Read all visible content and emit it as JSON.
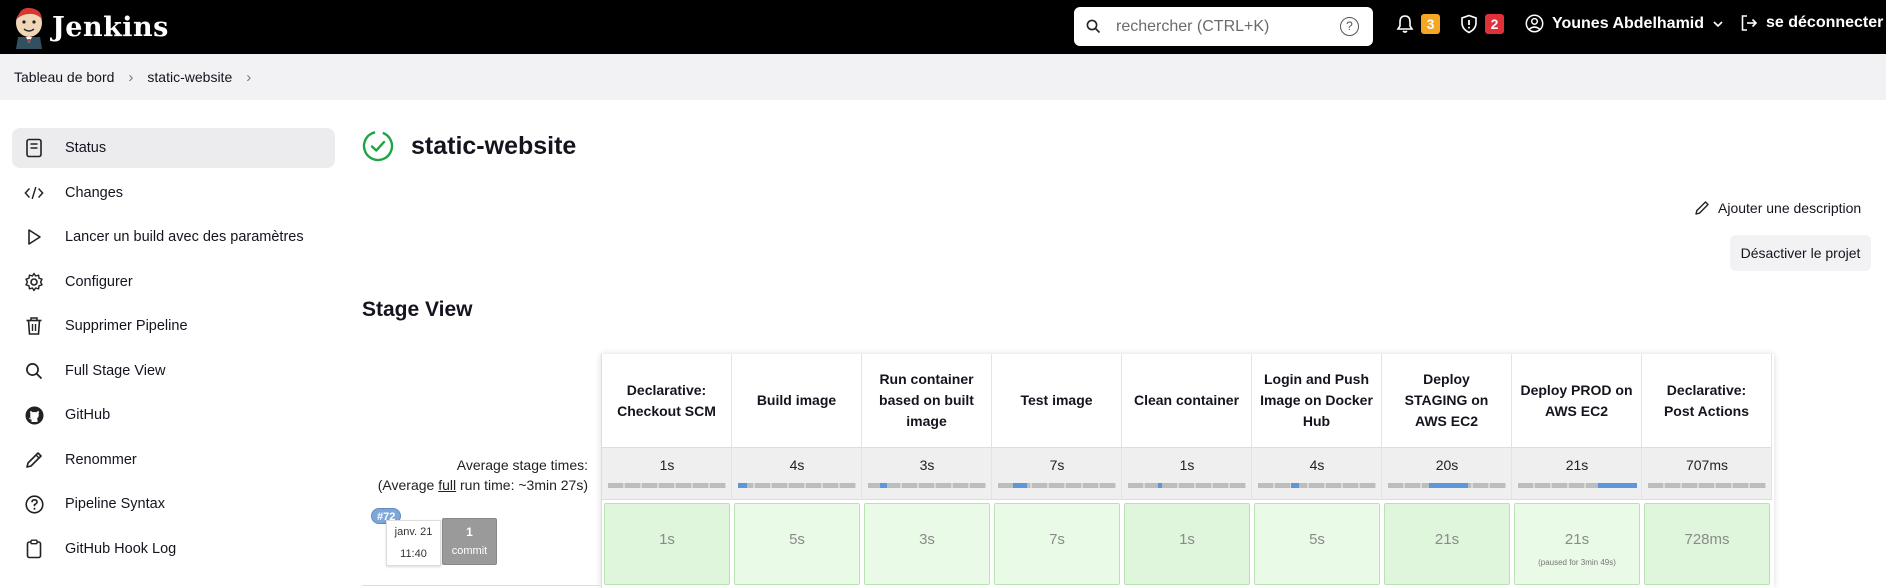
{
  "header": {
    "brand": "Jenkins",
    "search_placeholder": "rechercher (CTRL+K)",
    "help_glyph": "?",
    "notifications_count": "3",
    "security_count": "2",
    "user_name": "Younes Abdelhamid",
    "logout_label": "se déconnecter",
    "colors": {
      "background": "#000000",
      "notification_badge": "#f5a623",
      "security_badge": "#e0303a"
    }
  },
  "breadcrumb": {
    "items": [
      "Tableau de bord",
      "static-website"
    ],
    "sep": "›"
  },
  "sidebar": {
    "items": [
      {
        "label": "Status",
        "icon": "document-icon",
        "active": true
      },
      {
        "label": "Changes",
        "icon": "code-icon"
      },
      {
        "label": "Lancer un build avec des paramètres",
        "icon": "play-icon"
      },
      {
        "label": "Configurer",
        "icon": "gear-icon"
      },
      {
        "label": "Supprimer Pipeline",
        "icon": "trash-icon"
      },
      {
        "label": "Full Stage View",
        "icon": "search-icon"
      },
      {
        "label": "GitHub",
        "icon": "github-icon"
      },
      {
        "label": "Renommer",
        "icon": "pencil-icon"
      },
      {
        "label": "Pipeline Syntax",
        "icon": "help-circle-icon"
      },
      {
        "label": "GitHub Hook Log",
        "icon": "clipboard-icon"
      }
    ]
  },
  "main": {
    "title": "static-website",
    "status": "success",
    "add_description": "Ajouter une description",
    "disable_project": "Désactiver le projet",
    "stage_view_title": "Stage View",
    "avg_stage_times": "Average stage times:",
    "avg_full_prefix": "(Average ",
    "avg_full_word": "full",
    "avg_full_suffix": " run time: ~3min 27s)"
  },
  "stage_view": {
    "stages": [
      {
        "name": "Declarative: Checkout SCM",
        "avg": "1s",
        "bar_start": 0.0,
        "bar_fraction": 0.0
      },
      {
        "name": "Build image",
        "avg": "4s",
        "bar_start": 0.0,
        "bar_fraction": 0.08
      },
      {
        "name": "Run container based on built image",
        "avg": "3s",
        "bar_start": 0.1,
        "bar_fraction": 0.06
      },
      {
        "name": "Test image",
        "avg": "7s",
        "bar_start": 0.13,
        "bar_fraction": 0.12
      },
      {
        "name": "Clean container",
        "avg": "1s",
        "bar_start": 0.25,
        "bar_fraction": 0.03
      },
      {
        "name": "Login and Push Image on Docker Hub",
        "avg": "4s",
        "bar_start": 0.28,
        "bar_fraction": 0.07
      },
      {
        "name": "Deploy STAGING on AWS EC2",
        "avg": "20s",
        "bar_start": 0.35,
        "bar_fraction": 0.33
      },
      {
        "name": "Deploy PROD on AWS EC2",
        "avg": "21s",
        "bar_start": 0.68,
        "bar_fraction": 0.33
      },
      {
        "name": "Declarative: Post Actions",
        "avg": "707ms",
        "bar_start": 0.0,
        "bar_fraction": 0.0
      }
    ],
    "builds": [
      {
        "number": "#72",
        "date": "janv. 21",
        "time": "11:40",
        "commits_count": "1",
        "commits_label": "commit",
        "cells": [
          {
            "time": "1s",
            "shade": "dark"
          },
          {
            "time": "5s",
            "shade": "light"
          },
          {
            "time": "3s",
            "shade": "light"
          },
          {
            "time": "7s",
            "shade": "light"
          },
          {
            "time": "1s",
            "shade": "dark"
          },
          {
            "time": "5s",
            "shade": "light"
          },
          {
            "time": "21s",
            "shade": "dark"
          },
          {
            "time": "21s",
            "shade": "light",
            "note": "(paused for 3min 49s)"
          },
          {
            "time": "728ms",
            "shade": "dark"
          }
        ]
      }
    ],
    "colors": {
      "success_dark": "#dff6dc",
      "success_light": "#e9fbe6",
      "bar_fill": "#5e96dc"
    }
  }
}
